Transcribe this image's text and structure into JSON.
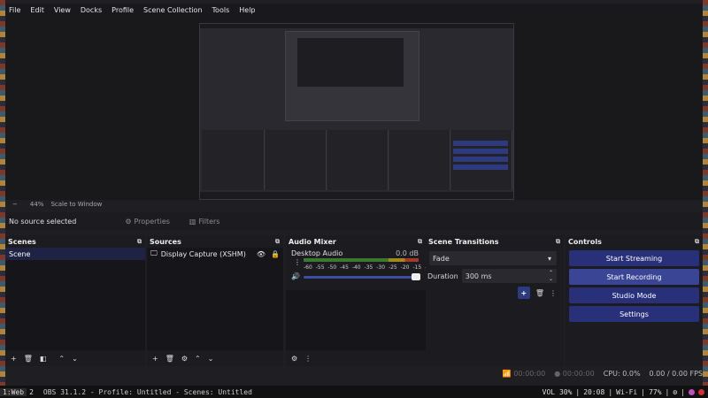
{
  "menu": [
    "File",
    "Edit",
    "View",
    "Docks",
    "Profile",
    "Scene Collection",
    "Tools",
    "Help"
  ],
  "zoom": {
    "minus": "−",
    "level": "44%",
    "mode": "Scale to Window"
  },
  "props": {
    "no_source": "No source selected",
    "properties": "Properties",
    "filters": "Filters"
  },
  "scenes": {
    "title": "Scenes",
    "items": [
      "Scene"
    ]
  },
  "sources": {
    "title": "Sources",
    "items": [
      {
        "name": "Display Capture (XSHM)"
      }
    ]
  },
  "mixer": {
    "title": "Audio Mixer",
    "track": {
      "name": "Desktop Audio",
      "db": "0.0 dB",
      "ticks": "-60 -55 -50 -45 -40 -35 -30 -25 -20 -15 -10 -5 0",
      "volume_fraction": 1.0
    }
  },
  "transitions": {
    "title": "Scene Transitions",
    "selected": "Fade",
    "duration_label": "Duration",
    "duration_value": "300 ms"
  },
  "controls": {
    "title": "Controls",
    "start_streaming": "Start Streaming",
    "start_recording": "Start Recording",
    "studio_mode": "Studio Mode",
    "settings": "Settings"
  },
  "status": {
    "stream_time": "00:00:00",
    "rec_time": "00:00:00",
    "cpu": "CPU: 0.0%",
    "fps": "0.00 / 0.00 FPS"
  },
  "taskbar": {
    "workspace_active": "1:Web",
    "workspace_2": "2",
    "window_title": "OBS 31.1.2 - Profile: Untitled - Scenes: Untitled",
    "vol": "VOL 30%",
    "time": "20:08",
    "wifi": "Wi-Fi",
    "battery": "77%",
    "sep": "|"
  },
  "colors": {
    "accent": "#28307a",
    "tray_purple": "#c050c0",
    "tray_red": "#d03030"
  }
}
